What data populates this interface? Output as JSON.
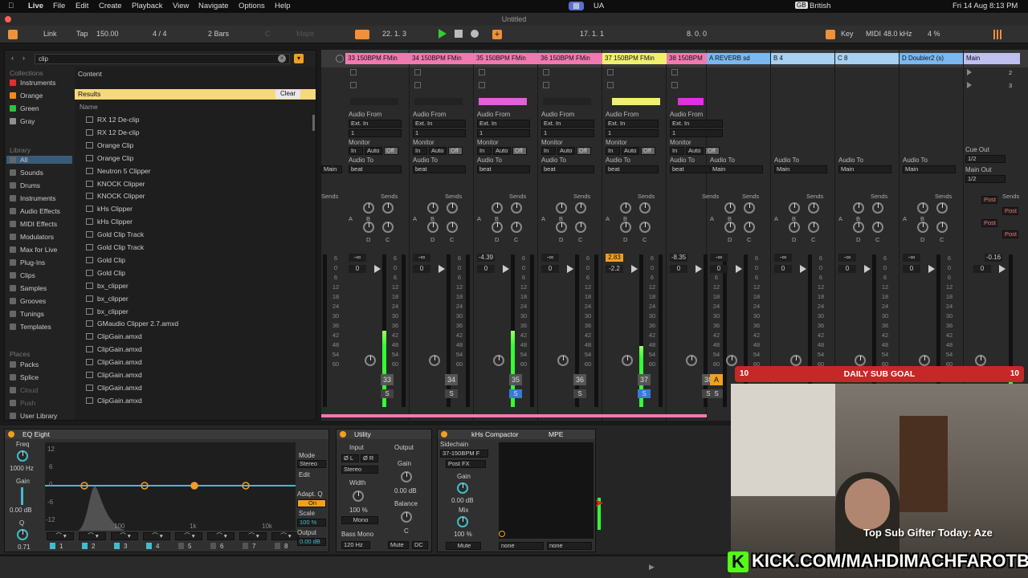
{
  "menubar": {
    "app": "Live",
    "items": [
      "File",
      "Edit",
      "Create",
      "Playback",
      "View",
      "Navigate",
      "Options",
      "Help"
    ],
    "right": {
      "ua": "UA",
      "lang": "British",
      "datetime": "Fri 14 Aug  8:13 PM"
    }
  },
  "window_title": "Untitled",
  "transport": {
    "link": "Link",
    "tap": "Tap",
    "bpm": "150.00",
    "signature": "4 / 4",
    "quantize": "2 Bars",
    "key_placeholder": "C",
    "scale_placeholder": "Major",
    "position": "22.   1.   3",
    "loop_start": "17.   1.   1",
    "loop_length": "8.   0.   0",
    "key_label": "Key",
    "midi_label": "MIDI",
    "sample_rate": "48.0 kHz",
    "cpu": "4 %"
  },
  "browser": {
    "search_value": "clip",
    "collections_header": "Collections",
    "collections": [
      {
        "label": "Instruments",
        "color": "#e03030"
      },
      {
        "label": "Orange",
        "color": "#f08a20"
      },
      {
        "label": "Green",
        "color": "#30c040"
      },
      {
        "label": "Gray",
        "color": "#909090"
      }
    ],
    "library_header": "Library",
    "library": [
      "All",
      "Sounds",
      "Drums",
      "Instruments",
      "Audio Effects",
      "MIDI Effects",
      "Modulators",
      "Max for Live",
      "Plug-Ins",
      "Clips",
      "Samples",
      "Grooves",
      "Tunings",
      "Templates"
    ],
    "places_header": "Places",
    "places": [
      "Packs",
      "Splice",
      "Cloud",
      "Push",
      "User Library"
    ],
    "content_label": "Content",
    "results_label": "Results",
    "clear_label": "Clear",
    "name_header": "Name",
    "results": [
      "RX 12 De-clip",
      "RX 12 De-clip",
      "Orange Clip",
      "Orange Clip",
      "Neutron 5 Clipper",
      "KNOCK Clipper",
      "KNOCK Clipper",
      "kHs Clipper",
      "kHs Clipper",
      "Gold Clip Track",
      "Gold Clip Track",
      "Gold Clip",
      "Gold Clip",
      "bx_clipper",
      "bx_clipper",
      "bx_clipper",
      "GMaudio Clipper 2.7.amxd",
      "ClipGain.amxd",
      "ClipGain.amxd",
      "ClipGain.amxd",
      "ClipGain.amxd",
      "ClipGain.amxd",
      "ClipGain.amxd"
    ]
  },
  "tracks": [
    {
      "name": "33 150BPM FMin",
      "color": "#f07ab0",
      "num": "33",
      "vol": "-∞",
      "pan": "0",
      "solo_active": false,
      "meter": 0.5,
      "clip_color": null
    },
    {
      "name": "34 150BPM FMin",
      "color": "#f07ab0",
      "num": "34",
      "vol": "-∞",
      "pan": "0",
      "solo_active": false,
      "meter": 0,
      "clip_color": null
    },
    {
      "name": "35 150BPM FMin",
      "color": "#f07ab0",
      "num": "35",
      "vol": "-4.39",
      "pan": "0",
      "solo_active": true,
      "meter": 0.5,
      "clip_color": "#e060e0"
    },
    {
      "name": "36 150BPM FMin",
      "color": "#f07ab0",
      "num": "36",
      "vol": "-∞",
      "pan": "0",
      "solo_active": false,
      "meter": 0,
      "clip_color": null
    },
    {
      "name": "37 150BPM FMin",
      "color": "#f0f070",
      "num": "37",
      "vol": "2.83",
      "pan": "-2.2",
      "solo_active": true,
      "meter": 0.4,
      "clip_color": "#f0f070"
    },
    {
      "name": "38 150BPM",
      "color": "#f07ab0",
      "num": "38",
      "vol": "-8.35",
      "pan": "0",
      "solo_active": false,
      "meter": 0,
      "clip_color": "#e030e0"
    }
  ],
  "returns": [
    {
      "name": "A REVERB sd",
      "color": "#7ab8f0",
      "vol": "-∞",
      "pan": "0",
      "letter": "A"
    },
    {
      "name": "B 4",
      "color": "#a8d0f0",
      "vol": "-∞",
      "pan": "0",
      "letter": "B"
    },
    {
      "name": "C 8",
      "color": "#a8d0f0",
      "vol": "-∞",
      "pan": "0",
      "letter": "C"
    },
    {
      "name": "D Doubler2 (s)",
      "color": "#7ab8f0",
      "vol": "-∞",
      "pan": "0",
      "letter": "D"
    }
  ],
  "master": {
    "name": "Main",
    "color": "#c0c0f0",
    "vol": "-0.16",
    "pan": "0",
    "scenes": [
      "2",
      "3"
    ],
    "cue_out_label": "Cue Out",
    "cue_out": "1/2",
    "main_out_label": "Main Out",
    "main_out": "1/2",
    "post": "Post"
  },
  "track_io": {
    "audio_from": "Audio From",
    "ext_in": "Ext. In",
    "input_ch": "1",
    "monitor": "Monitor",
    "in": "In",
    "auto": "Auto",
    "off": "Off",
    "audio_to": "Audio To",
    "beat": "beat",
    "main": "Main",
    "sends": "Sends",
    "send_letters": [
      "A",
      "B",
      "C",
      "D"
    ],
    "s": "S"
  },
  "meter_scale": [
    "6",
    "0",
    "6",
    "12",
    "18",
    "24",
    "30",
    "36",
    "42",
    "48",
    "54",
    "60"
  ],
  "devices": {
    "eq": {
      "name": "EQ Eight",
      "freq_label": "Freq",
      "freq": "1000 Hz",
      "gain_label": "Gain",
      "gain": "0.00 dB",
      "q_label": "Q",
      "q": "0.71",
      "mode_label": "Mode",
      "mode": "Stereo",
      "edit_label": "Edit",
      "adapt_label": "Adapt. Q",
      "adapt": "On",
      "scale_label": "Scale",
      "scale": "100 %",
      "output_label": "Output",
      "output": "0.00 dB",
      "db_ticks": [
        "12",
        "6",
        "0",
        "-6",
        "-12"
      ],
      "freq_ticks": [
        "100",
        "1k",
        "10k"
      ],
      "bands": [
        "1",
        "2",
        "3",
        "4",
        "5",
        "6",
        "7",
        "8"
      ]
    },
    "utility": {
      "name": "Utility",
      "input_label": "Input",
      "output_label": "Output",
      "phase_l": "Ø L",
      "phase_r": "Ø R",
      "stereo": "Stereo",
      "gain_label": "Gain",
      "gain": "0.00 dB",
      "width_label": "Width",
      "width": "100 %",
      "balance_label": "Balance",
      "balance": "C",
      "mono": "Mono",
      "bass_mono": "Bass Mono",
      "bass_freq": "120 Hz",
      "mute": "Mute",
      "dc": "DC"
    },
    "comp": {
      "name": "kHs Compactor",
      "mpe": "MPE",
      "sidechain_label": "Sidechain",
      "sidechain": "37-150BPM F",
      "postfx": "Post FX",
      "gain_label": "Gain",
      "gain": "0.00 dB",
      "mix_label": "Mix",
      "mix": "100 %",
      "mute": "Mute",
      "none1": "none",
      "none2": "none"
    }
  },
  "overlay": {
    "subgoal": "DAILY SUB GOAL",
    "subgoal_left": "10",
    "subgoal_right": "10",
    "gifter": "Top Sub Gifter Today: Aze",
    "kick_url": "KICK.COM/MAHDIMACHFAROTB",
    "kick_logo": "K"
  }
}
